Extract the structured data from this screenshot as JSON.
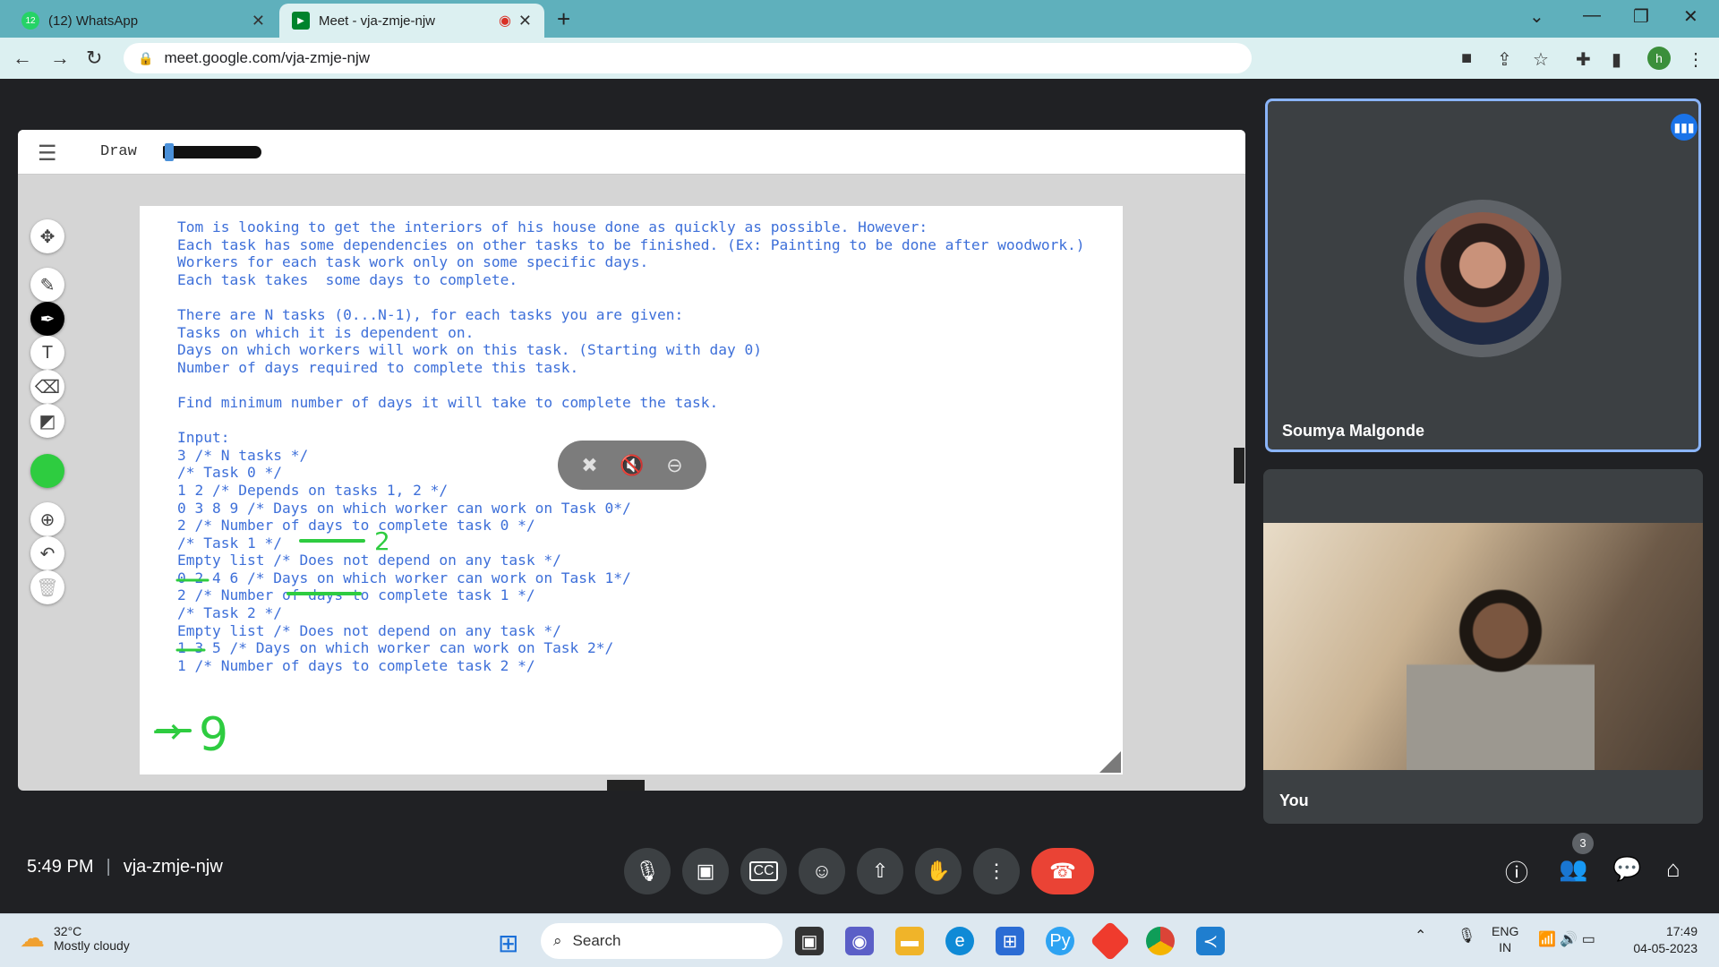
{
  "browser": {
    "tabs": [
      {
        "title": "(12) WhatsApp",
        "icon": "whatsapp-icon",
        "badge": "12"
      },
      {
        "title": "Meet - vja-zmje-njw",
        "icon": "google-meet-icon",
        "recording": true
      }
    ],
    "url": "meet.google.com/vja-zmje-njw",
    "profile_initial": "h"
  },
  "jamboard": {
    "mode_label": "Draw",
    "problem_lines": [
      "Tom is looking to get the interiors of his house done as quickly as possible. However:",
      "Each task has some dependencies on other tasks to be finished. (Ex: Painting to be done after woodwork.)",
      "Workers for each task work only on some specific days.",
      "Each task takes  some days to complete.",
      "",
      "There are N tasks (0...N-1), for each tasks you are given:",
      "Tasks on which it is dependent on.",
      "Days on which workers will work on this task. (Starting with day 0)",
      "Number of days required to complete this task.",
      "",
      "Find minimum number of days it will take to complete the task.",
      "",
      "Input:",
      "3 /* N tasks */",
      "/* Task 0 */",
      "1 2 /* Depends on tasks 1, 2 */",
      "0 3 8 9 /* Days on which worker can work on Task 0*/",
      "2 /* Number of days to complete task 0 */",
      "/* Task 1 */",
      "Empty list /* Does not depend on any task */",
      "0 2 4 6 /* Days on which worker can work on Task 1*/",
      "2 /* Number of days to complete task 1 */",
      "/* Task 2 */",
      "Empty list /* Does not depend on any task */",
      "1 3 5 /* Days on which worker can work on Task 2*/",
      "1 /* Number of days to complete task 2 */"
    ],
    "handwriting": {
      "task1_note": "2",
      "answer_arrow": "→",
      "answer_value": "9"
    },
    "pen_color": "#2ecc40",
    "text_color": "#3d6fd9"
  },
  "participants": [
    {
      "name": "Soumya Malgonde",
      "speaking": true
    },
    {
      "name": "You"
    }
  ],
  "meeting": {
    "time": "5:49 PM",
    "code": "vja-zmje-njw",
    "people_count": "3"
  },
  "taskbar": {
    "weather_temp": "32°C",
    "weather_desc": "Mostly cloudy",
    "search_label": "Search",
    "lang_line1": "ENG",
    "lang_line2": "IN",
    "clock_time": "17:49",
    "clock_date": "04-05-2023"
  }
}
